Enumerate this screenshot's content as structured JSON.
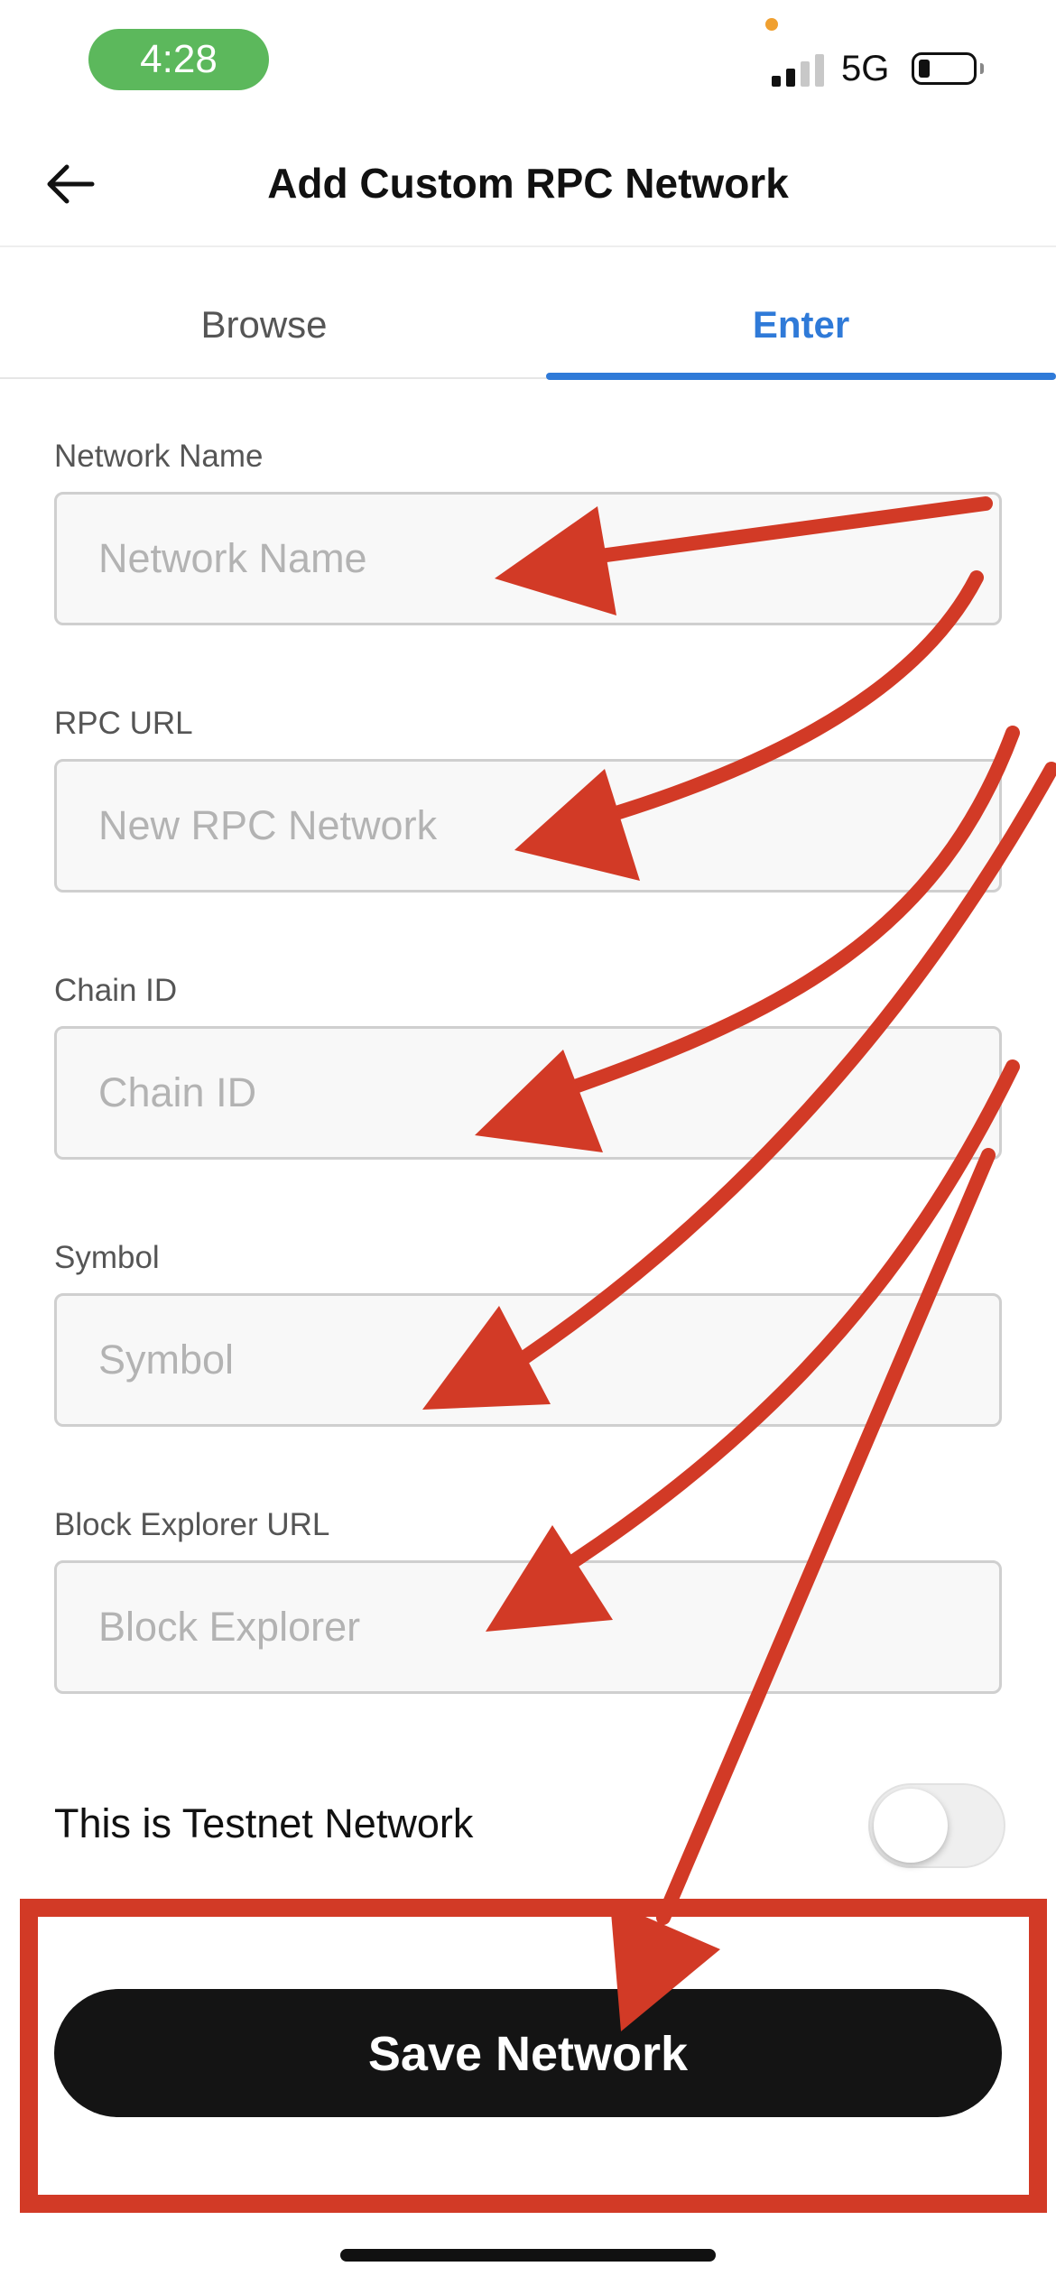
{
  "status_bar": {
    "time": "4:28",
    "network": "5G"
  },
  "header": {
    "title": "Add Custom RPC Network",
    "back_icon": "arrow-left-icon"
  },
  "tabs": [
    {
      "label": "Browse",
      "active": false
    },
    {
      "label": "Enter",
      "active": true
    }
  ],
  "form": {
    "fields": [
      {
        "label": "Network Name",
        "placeholder": "Network Name",
        "value": ""
      },
      {
        "label": "RPC URL",
        "placeholder": "New RPC Network",
        "value": ""
      },
      {
        "label": "Chain ID",
        "placeholder": "Chain ID",
        "value": ""
      },
      {
        "label": "Symbol",
        "placeholder": "Symbol",
        "value": ""
      },
      {
        "label": "Block Explorer URL",
        "placeholder": "Block Explorer",
        "value": ""
      }
    ],
    "testnet_toggle": {
      "label": "This is Testnet Network",
      "on": false
    }
  },
  "save_button": {
    "label": "Save Network"
  },
  "colors": {
    "accent": "#2f7ad8",
    "button_bg": "#141414",
    "annotation": "#d23a26",
    "status_pill": "#5cb85c"
  }
}
